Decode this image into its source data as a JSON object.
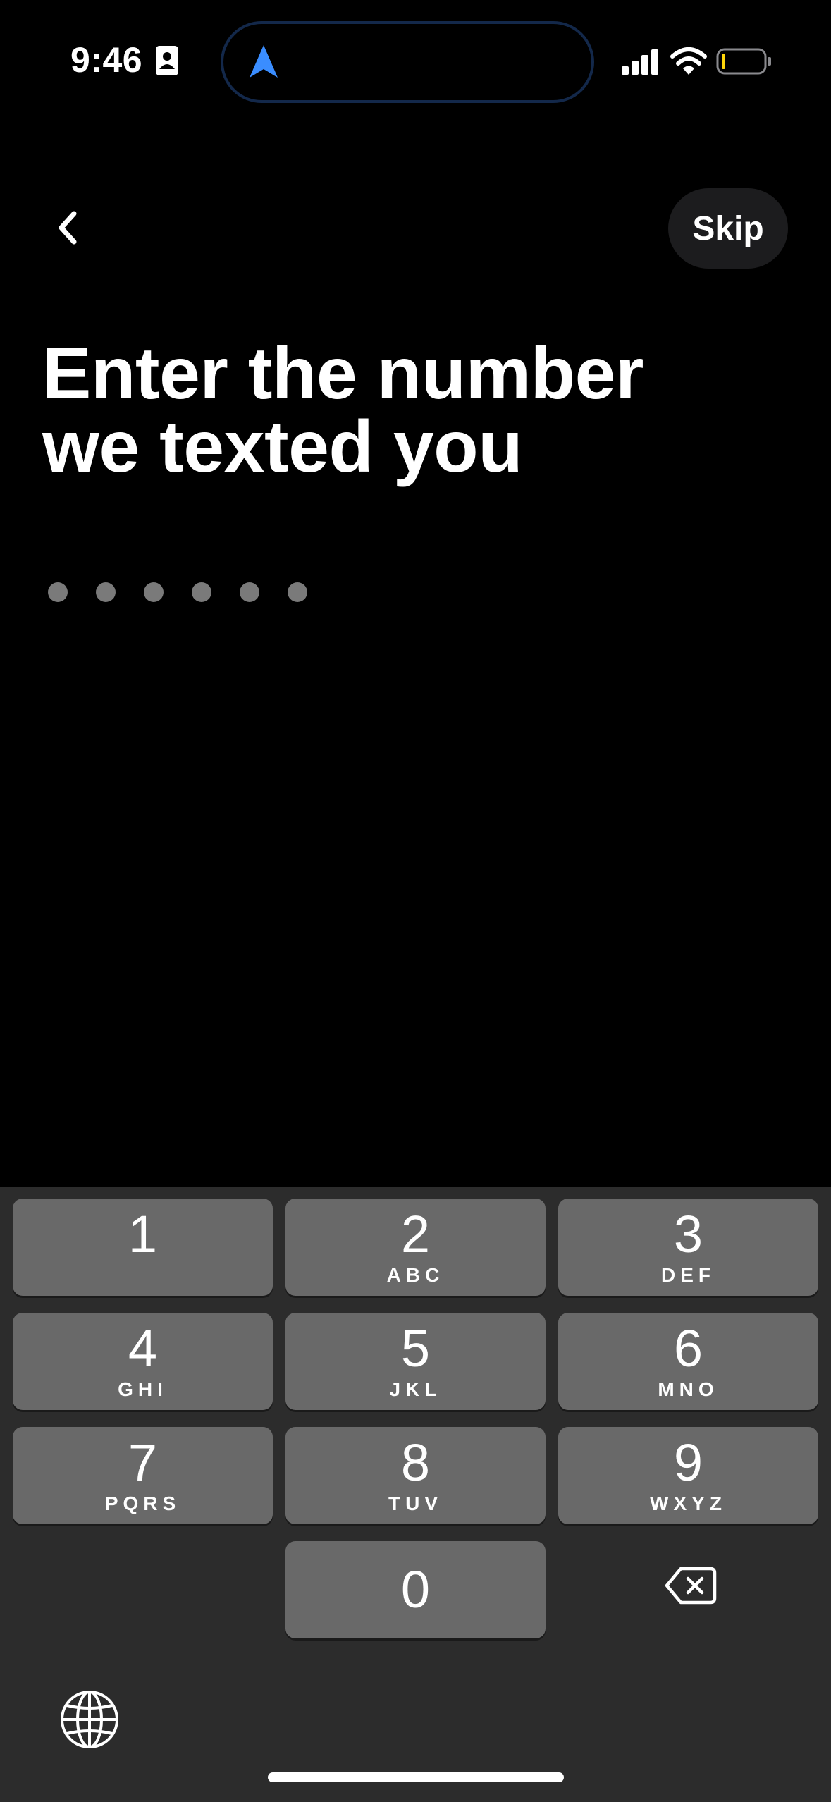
{
  "status_bar": {
    "time": "9:46",
    "icons": [
      "contact-card-icon",
      "navigation-arrow-icon",
      "cellular-signal-icon",
      "wifi-icon",
      "battery-icon"
    ],
    "accent_color": "#3a8dff",
    "battery_color": "#ffd60a"
  },
  "header": {
    "back_icon": "chevron-left-icon",
    "skip_label": "Skip"
  },
  "title": {
    "line1": "Enter the number",
    "line2": "we texted you"
  },
  "code_input": {
    "length": 6,
    "entered": 0
  },
  "keypad": {
    "keys": [
      {
        "digit": "1",
        "letters": ""
      },
      {
        "digit": "2",
        "letters": "ABC"
      },
      {
        "digit": "3",
        "letters": "DEF"
      },
      {
        "digit": "4",
        "letters": "GHI"
      },
      {
        "digit": "5",
        "letters": "JKL"
      },
      {
        "digit": "6",
        "letters": "MNO"
      },
      {
        "digit": "7",
        "letters": "PQRS"
      },
      {
        "digit": "8",
        "letters": "TUV"
      },
      {
        "digit": "9",
        "letters": "WXYZ"
      },
      {
        "digit": "0",
        "letters": ""
      }
    ],
    "backspace_icon": "backspace-icon",
    "globe_icon": "globe-icon"
  }
}
